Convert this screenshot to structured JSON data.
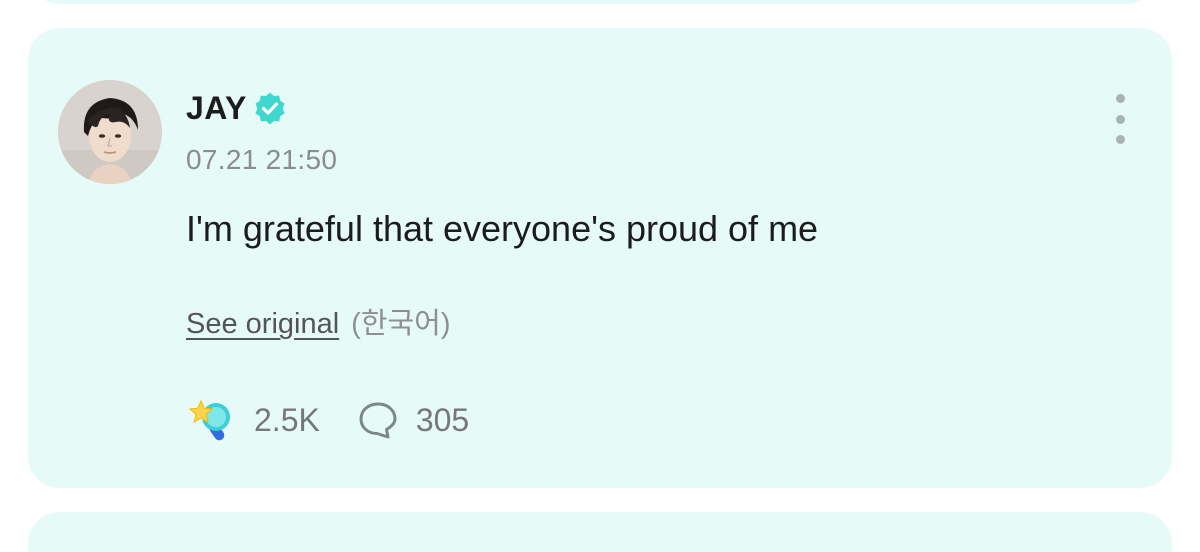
{
  "post": {
    "author": {
      "name": "JAY",
      "verified": true,
      "avatar_icon": "profile-photo"
    },
    "timestamp": "07.21 21:50",
    "content": "I'm grateful that everyone's proud of me",
    "translation": {
      "see_original_label": "See original",
      "original_language": "(한국어)"
    },
    "stats": {
      "reactions": "2.5K",
      "comments": "305"
    },
    "icons": {
      "verified": "verified-badge-icon",
      "more": "more-vertical-icon",
      "reaction": "reaction-stick-icon",
      "comment": "comment-bubble-icon"
    }
  },
  "theme": {
    "card_background": "#e6fbf7",
    "verified_color": "#3fd8cf",
    "text_primary": "#1c1c1c",
    "text_secondary": "#8c8c8c"
  }
}
